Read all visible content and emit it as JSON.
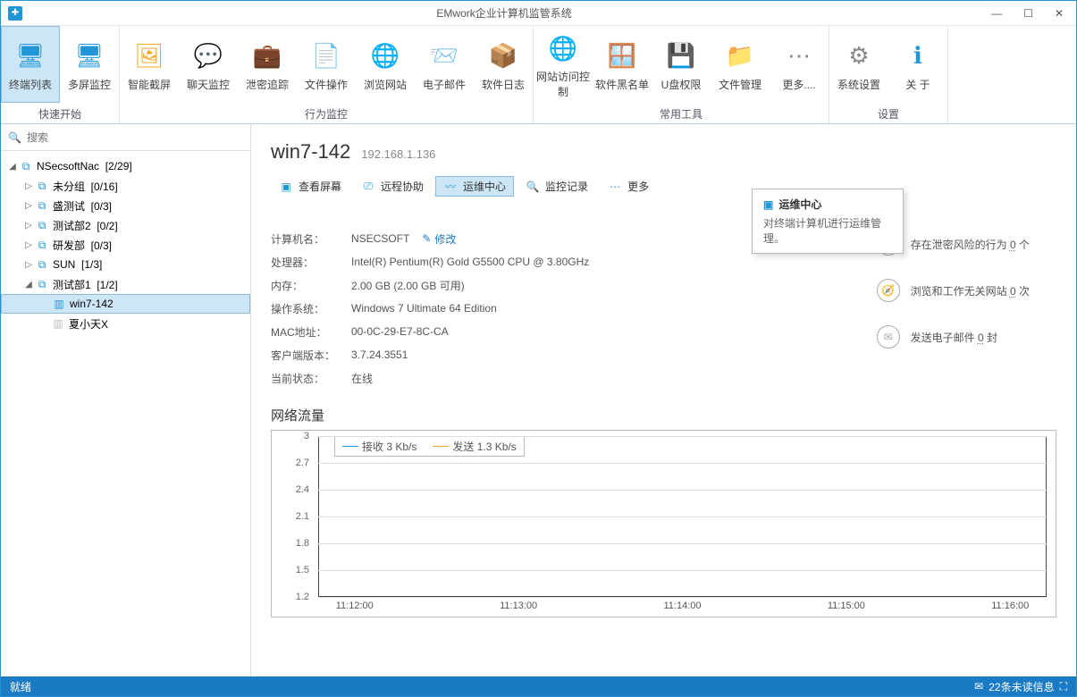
{
  "window": {
    "title": "EMwork企业计算机监管系统"
  },
  "ribbon": {
    "groups": [
      {
        "label": "快速开始",
        "items": [
          {
            "id": "terminal-list",
            "label": "终端列表",
            "icon": "monitors-icon",
            "color": "#2196d6",
            "active": true
          },
          {
            "id": "multi-screen",
            "label": "多屏监控",
            "icon": "monitor-icon",
            "color": "#2196d6"
          }
        ]
      },
      {
        "label": "行为监控",
        "items": [
          {
            "id": "smart-cap",
            "label": "智能截屏",
            "icon": "image-icon",
            "color": "#f5a623"
          },
          {
            "id": "chat-mon",
            "label": "聊天监控",
            "icon": "chat-icon",
            "color": "#2196d6"
          },
          {
            "id": "leak-trace",
            "label": "泄密追踪",
            "icon": "briefcase-icon",
            "color": "#2196d6"
          },
          {
            "id": "file-op",
            "label": "文件操作",
            "icon": "doc-icon",
            "color": "#f5a623"
          },
          {
            "id": "browse",
            "label": "浏览网站",
            "icon": "globe-icon",
            "color": "#2196d6"
          },
          {
            "id": "email",
            "label": "电子邮件",
            "icon": "mailbox-icon",
            "color": "#2196d6"
          },
          {
            "id": "swlog",
            "label": "软件日志",
            "icon": "cube-icon",
            "color": "#66bb6a"
          }
        ]
      },
      {
        "label": "常用工具",
        "items": [
          {
            "id": "site-ctrl",
            "label": "网站访问控制",
            "icon": "globe-block-icon",
            "color": "#f5a623"
          },
          {
            "id": "sw-blacklist",
            "label": "软件黑名单",
            "icon": "window-block-icon",
            "color": "#2196d6"
          },
          {
            "id": "usb-perm",
            "label": "U盘权限",
            "icon": "usb-icon",
            "color": "#2196d6"
          },
          {
            "id": "file-mgr",
            "label": "文件管理",
            "icon": "folder-icon",
            "color": "#f5a623"
          },
          {
            "id": "more",
            "label": "更多....",
            "icon": "more-icon",
            "color": "#888"
          }
        ]
      },
      {
        "label": "设置",
        "items": [
          {
            "id": "sys-set",
            "label": "系统设置",
            "icon": "gear-icon",
            "color": "#888"
          },
          {
            "id": "about",
            "label": "关  于",
            "icon": "info-icon",
            "color": "#2196d6"
          }
        ]
      }
    ]
  },
  "search": {
    "placeholder": "搜索"
  },
  "tree": {
    "root": {
      "label": "NSecsoftNac",
      "count": "[2/29]"
    },
    "groups": [
      {
        "label": "未分组",
        "count": "[0/16]"
      },
      {
        "label": "盛测试",
        "count": "[0/3]"
      },
      {
        "label": "测试部2",
        "count": "[0/2]"
      },
      {
        "label": "研发部",
        "count": "[0/3]"
      },
      {
        "label": "SUN",
        "count": "[1/3]"
      },
      {
        "label": "测试部1",
        "count": "[1/2]",
        "expanded": true,
        "children": [
          {
            "label": "win7-142",
            "online": true,
            "selected": true
          },
          {
            "label": "夏小天X",
            "online": false
          }
        ]
      }
    ]
  },
  "detail": {
    "hostname": "win7-142",
    "ip": "192.168.1.136",
    "actions": [
      {
        "id": "view-screen",
        "label": "查看屏幕"
      },
      {
        "id": "remote-assist",
        "label": "远程协助"
      },
      {
        "id": "ops-center",
        "label": "运维中心",
        "active": true
      },
      {
        "id": "monitor-log",
        "label": "监控记录"
      },
      {
        "id": "more-actions",
        "label": "更多"
      }
    ],
    "tooltip": {
      "title": "运维中心",
      "desc": "对终端计算机进行运维管理。"
    },
    "info": [
      {
        "k": "计算机名：",
        "v": "NSECSOFT",
        "edit": "修改"
      },
      {
        "k": "处理器：",
        "v": "Intel(R) Pentium(R) Gold G5500 CPU @ 3.80GHz"
      },
      {
        "k": "内存：",
        "v": "2.00 GB (2.00 GB 可用)"
      },
      {
        "k": "操作系统：",
        "v": "Windows 7 Ultimate 64 Edition"
      },
      {
        "k": "MAC地址：",
        "v": "00-0C-29-E7-8C-CA"
      },
      {
        "k": "客户端版本：",
        "v": "3.7.24.3551"
      },
      {
        "k": "当前状态：",
        "v": "在线"
      }
    ],
    "stats": [
      {
        "icon": "lock-icon",
        "pre": "存在泄密风险的行为 ",
        "num": "0",
        "suf": " 个"
      },
      {
        "icon": "compass-icon",
        "pre": "浏览和工作无关网站 ",
        "num": "0",
        "suf": " 次"
      },
      {
        "icon": "envelope-icon",
        "pre": "发送电子邮件 ",
        "num": "0",
        "suf": " 封"
      }
    ]
  },
  "chart_data": {
    "type": "line",
    "title": "网络流量",
    "series": [
      {
        "name": "接收 3 Kb/s",
        "color": "#2196d6"
      },
      {
        "name": "发送 1.3 Kb/s",
        "color": "#f5a623"
      }
    ],
    "yticks": [
      1.2,
      1.5,
      1.8,
      2.1,
      2.4,
      2.7,
      3
    ],
    "ylim": [
      1.2,
      3
    ],
    "x": [
      "11:12:00",
      "11:13:00",
      "11:14:00",
      "11:15:00",
      "11:16:00"
    ],
    "values_recv": [
      3,
      3,
      3,
      3,
      3
    ],
    "values_send": [
      1.3,
      1.3,
      1.3,
      1.3,
      1.3
    ]
  },
  "statusbar": {
    "left": "就绪",
    "right": "22条未读信息"
  }
}
